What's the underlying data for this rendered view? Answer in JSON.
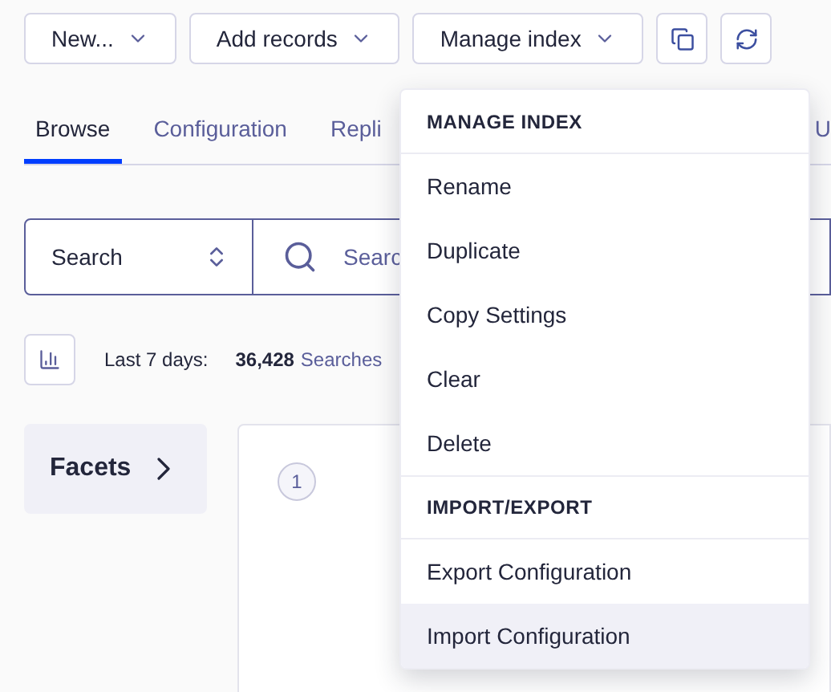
{
  "toolbar": {
    "buttons": [
      {
        "label": "New...",
        "kind": "dropdown"
      },
      {
        "label": "Add records",
        "kind": "dropdown"
      },
      {
        "label": "Manage index",
        "kind": "dropdown"
      },
      {
        "kind": "copy"
      },
      {
        "kind": "refresh"
      }
    ]
  },
  "tabs": [
    {
      "label": "Browse",
      "selected": true
    },
    {
      "label": "Configuration",
      "selected": false
    },
    {
      "label": "Repli",
      "selected": false
    },
    {
      "label": "U",
      "selected": false
    }
  ],
  "search": {
    "mode": "Search",
    "placeholder": "Searc"
  },
  "stats": {
    "label": "Last 7 days:",
    "count": "36,428",
    "unit": "Searches"
  },
  "facets": {
    "label": "Facets"
  },
  "results": {
    "page": "1"
  },
  "menu": {
    "items": [
      {
        "kind": "header",
        "label": "MANAGE INDEX"
      },
      {
        "kind": "item",
        "label": "Rename",
        "highlighted": false
      },
      {
        "kind": "item",
        "label": "Duplicate",
        "highlighted": false
      },
      {
        "kind": "item",
        "label": "Copy Settings",
        "highlighted": false
      },
      {
        "kind": "item",
        "label": "Clear",
        "highlighted": false
      },
      {
        "kind": "item",
        "label": "Delete",
        "highlighted": false
      },
      {
        "kind": "header",
        "label": "IMPORT/EXPORT"
      },
      {
        "kind": "item",
        "label": "Export Configuration",
        "highlighted": false
      },
      {
        "kind": "item",
        "label": "Import Configuration",
        "highlighted": true
      }
    ]
  }
}
